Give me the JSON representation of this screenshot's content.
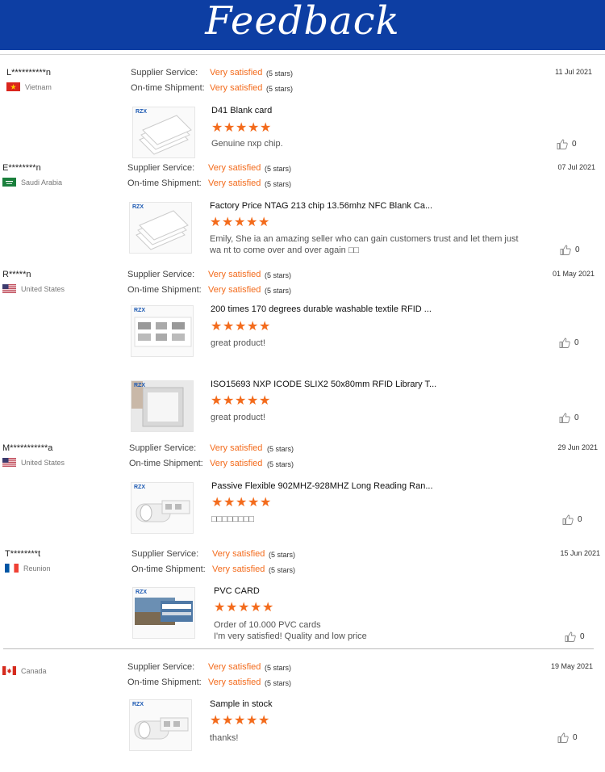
{
  "header": {
    "title": "Feedback"
  },
  "labels": {
    "supplier_service": "Supplier Service:",
    "ontime_shipment": "On-time Shipment:"
  },
  "colors": {
    "banner": "#0d3ea3",
    "accent": "#f36b1c"
  },
  "reviews": [
    {
      "name": "L**********n",
      "country": "Vietnam",
      "flag": "vietnam-flag",
      "date": "11 Jul 2021",
      "supplier_value": "Very satisfied",
      "supplier_stars": "(5 stars)",
      "shipment_value": "Very satisfied",
      "shipment_stars": "(5 stars)",
      "items": [
        {
          "product": "D41 Blank card",
          "rating": 5,
          "comment": "Genuine nxp chip.",
          "likes": "0",
          "image": "white-cards-image"
        }
      ]
    },
    {
      "name": "E********n",
      "country": "Saudi Arabia",
      "flag": "saudi-arabia-flag",
      "date": "07 Jul 2021",
      "supplier_value": "Very satisfied",
      "supplier_stars": "(5 stars)",
      "shipment_value": "Very satisfied",
      "shipment_stars": "(5 stars)",
      "items": [
        {
          "product": "Factory Price NTAG 213 chip 13.56mhz NFC Blank Ca...",
          "rating": 5,
          "comment": "Emily, She ia an amazing seller who can gain customers trust and let them just wa nt to come over and over again □□",
          "likes": "0",
          "image": "white-cards-image"
        }
      ]
    },
    {
      "name": "R*****n",
      "country": "United States",
      "flag": "usa-flag",
      "date": "01 May 2021",
      "supplier_value": "Very satisfied",
      "supplier_stars": "(5 stars)",
      "shipment_value": "Very satisfied",
      "shipment_stars": "(5 stars)",
      "items": [
        {
          "product": "200 times 170 degrees durable washable textile RFID ...",
          "rating": 5,
          "comment": "great product!",
          "likes": "0",
          "image": "textile-tags-image"
        },
        {
          "product": "ISO15693 NXP ICODE SLIX2 50x80mm RFID Library T...",
          "rating": 5,
          "comment": "great product!",
          "likes": "0",
          "image": "library-tag-image"
        }
      ]
    },
    {
      "name": "M***********a",
      "country": "United States",
      "flag": "usa-flag",
      "date": "29 Jun 2021",
      "supplier_value": "Very satisfied",
      "supplier_stars": "(5 stars)",
      "shipment_value": "Very satisfied",
      "shipment_stars": "(5 stars)",
      "items": [
        {
          "product": "Passive Flexible 902MHZ-928MHZ Long Reading Ran...",
          "rating": 5,
          "comment": "□□□□□□□□",
          "likes": "0",
          "image": "label-roll-image"
        }
      ]
    },
    {
      "name": "T********t",
      "country": "Reunion",
      "flag": "france-flag",
      "date": "15 Jun 2021",
      "supplier_value": "Very satisfied",
      "supplier_stars": "(5 stars)",
      "shipment_value": "Very satisfied",
      "shipment_stars": "(5 stars)",
      "items": [
        {
          "product": "PVC CARD",
          "rating": 5,
          "comment": "Order of 10.000 PVC cards\nI'm very satisfied! Quality and low price",
          "likes": "0",
          "image": "pvc-cards-image"
        }
      ]
    },
    {
      "name": "",
      "country": "Canada",
      "flag": "canada-flag",
      "date": "19 May 2021",
      "supplier_value": "Very satisfied",
      "supplier_stars": "(5 stars)",
      "shipment_value": "Very satisfied",
      "shipment_stars": "(5 stars)",
      "items": [
        {
          "product": "Sample in stock",
          "rating": 5,
          "comment": "thanks!",
          "likes": "0",
          "image": "label-roll-image"
        }
      ]
    }
  ],
  "brand_logo": "RZX"
}
